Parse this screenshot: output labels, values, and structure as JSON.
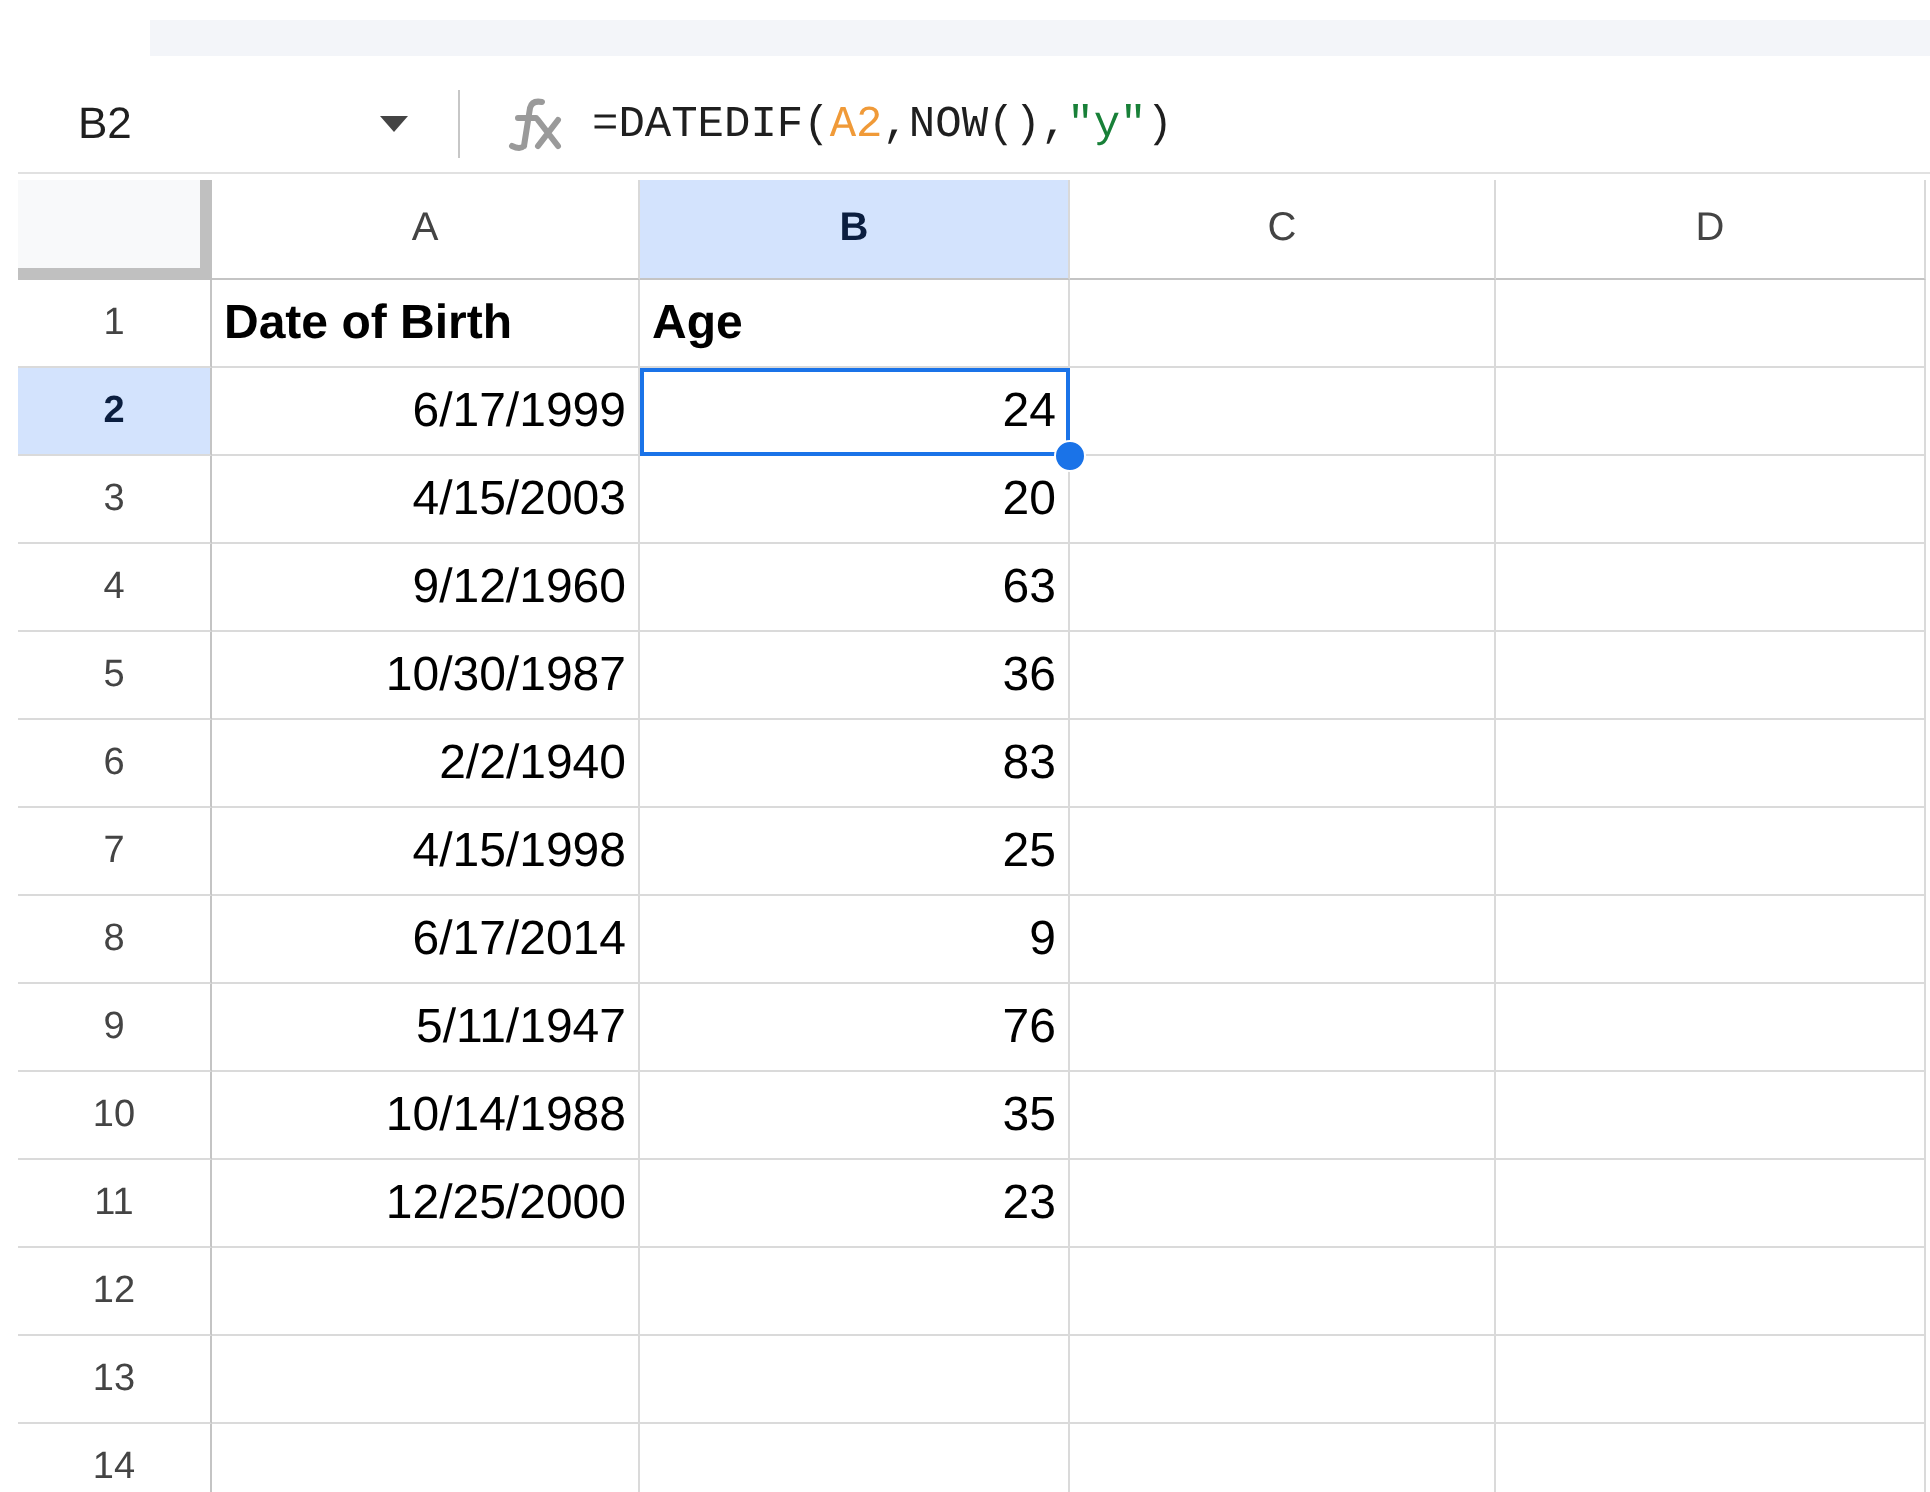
{
  "name_box": {
    "value": "B2"
  },
  "formula": [
    {
      "kind": "plain",
      "text": "=DATEDIF("
    },
    {
      "kind": "ref",
      "text": "A2"
    },
    {
      "kind": "plain",
      "text": ",NOW(),"
    },
    {
      "kind": "string",
      "text": "\"y\""
    },
    {
      "kind": "plain",
      "text": ")"
    }
  ],
  "columns": [
    {
      "label": "A",
      "selected": false
    },
    {
      "label": "B",
      "selected": true
    },
    {
      "label": "C",
      "selected": false
    },
    {
      "label": "D",
      "selected": false
    }
  ],
  "rows": [
    {
      "label": "1",
      "selected": false,
      "cells": [
        {
          "text": "Date of Birth",
          "kind": "header"
        },
        {
          "text": "Age",
          "kind": "header"
        }
      ]
    },
    {
      "label": "2",
      "selected": true,
      "cells": [
        {
          "text": "6/17/1999",
          "kind": "number"
        },
        {
          "text": "24",
          "kind": "number",
          "selected": true
        }
      ]
    },
    {
      "label": "3",
      "selected": false,
      "cells": [
        {
          "text": "4/15/2003",
          "kind": "number"
        },
        {
          "text": "20",
          "kind": "number"
        }
      ]
    },
    {
      "label": "4",
      "selected": false,
      "cells": [
        {
          "text": "9/12/1960",
          "kind": "number"
        },
        {
          "text": "63",
          "kind": "number"
        }
      ]
    },
    {
      "label": "5",
      "selected": false,
      "cells": [
        {
          "text": "10/30/1987",
          "kind": "number"
        },
        {
          "text": "36",
          "kind": "number"
        }
      ]
    },
    {
      "label": "6",
      "selected": false,
      "cells": [
        {
          "text": "2/2/1940",
          "kind": "number"
        },
        {
          "text": "83",
          "kind": "number"
        }
      ]
    },
    {
      "label": "7",
      "selected": false,
      "cells": [
        {
          "text": "4/15/1998",
          "kind": "number"
        },
        {
          "text": "25",
          "kind": "number"
        }
      ]
    },
    {
      "label": "8",
      "selected": false,
      "cells": [
        {
          "text": "6/17/2014",
          "kind": "number"
        },
        {
          "text": "9",
          "kind": "number"
        }
      ]
    },
    {
      "label": "9",
      "selected": false,
      "cells": [
        {
          "text": "5/11/1947",
          "kind": "number"
        },
        {
          "text": "76",
          "kind": "number"
        }
      ]
    },
    {
      "label": "10",
      "selected": false,
      "cells": [
        {
          "text": "10/14/1988",
          "kind": "number"
        },
        {
          "text": "35",
          "kind": "number"
        }
      ]
    },
    {
      "label": "11",
      "selected": false,
      "cells": [
        {
          "text": "12/25/2000",
          "kind": "number"
        },
        {
          "text": "23",
          "kind": "number"
        }
      ]
    },
    {
      "label": "12",
      "selected": false,
      "cells": []
    },
    {
      "label": "13",
      "selected": false,
      "cells": []
    },
    {
      "label": "14",
      "selected": false,
      "cells": []
    }
  ]
}
